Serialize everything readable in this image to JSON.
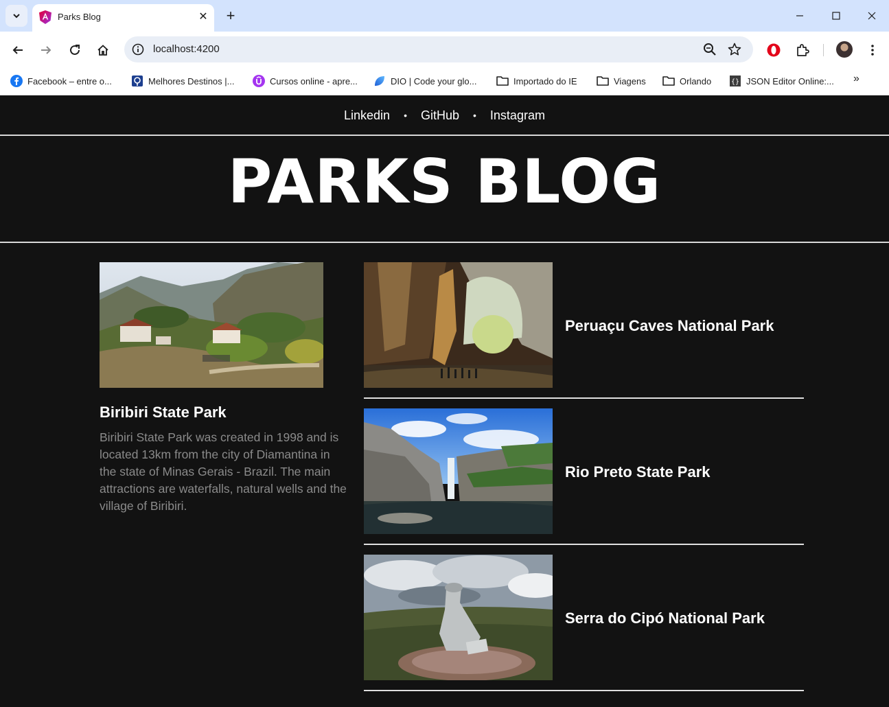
{
  "browser": {
    "tab_title": "Parks Blog",
    "url": "localhost:4200",
    "bookmarks": [
      {
        "label": "Facebook – entre o...",
        "icon": "facebook-icon"
      },
      {
        "label": "Melhores Destinos |...",
        "icon": "melhores-destinos-icon"
      },
      {
        "label": "Cursos online - apre...",
        "icon": "udemy-icon"
      },
      {
        "label": "DIO | Code your glo...",
        "icon": "dio-icon"
      },
      {
        "label": "Importado do IE",
        "icon": "folder-icon"
      },
      {
        "label": "Viagens",
        "icon": "folder-icon"
      },
      {
        "label": "Orlando",
        "icon": "folder-icon"
      },
      {
        "label": "JSON Editor Online:...",
        "icon": "json-editor-icon"
      }
    ],
    "accent_color": "#d3e3fd"
  },
  "nav": {
    "links": [
      "Linkedin",
      "GitHub",
      "Instagram"
    ],
    "separator": "•"
  },
  "header": {
    "title": "PARKS BLOG"
  },
  "featured": {
    "title": "Biribiri State Park",
    "description": "Biribiri State Park was created in 1998 and is located 13km from the city of Diamantina in the state of Minas Gerais - Brazil. The main attractions are waterfalls, natural wells and the village of Biribiri."
  },
  "posts": [
    {
      "title": "Peruaçu Caves National Park"
    },
    {
      "title": "Rio Preto State Park"
    },
    {
      "title": "Serra do Cipó National Park"
    }
  ],
  "colors": {
    "page_background": "#121212",
    "text_primary": "#ffffff",
    "text_muted": "#8a8a8a"
  }
}
